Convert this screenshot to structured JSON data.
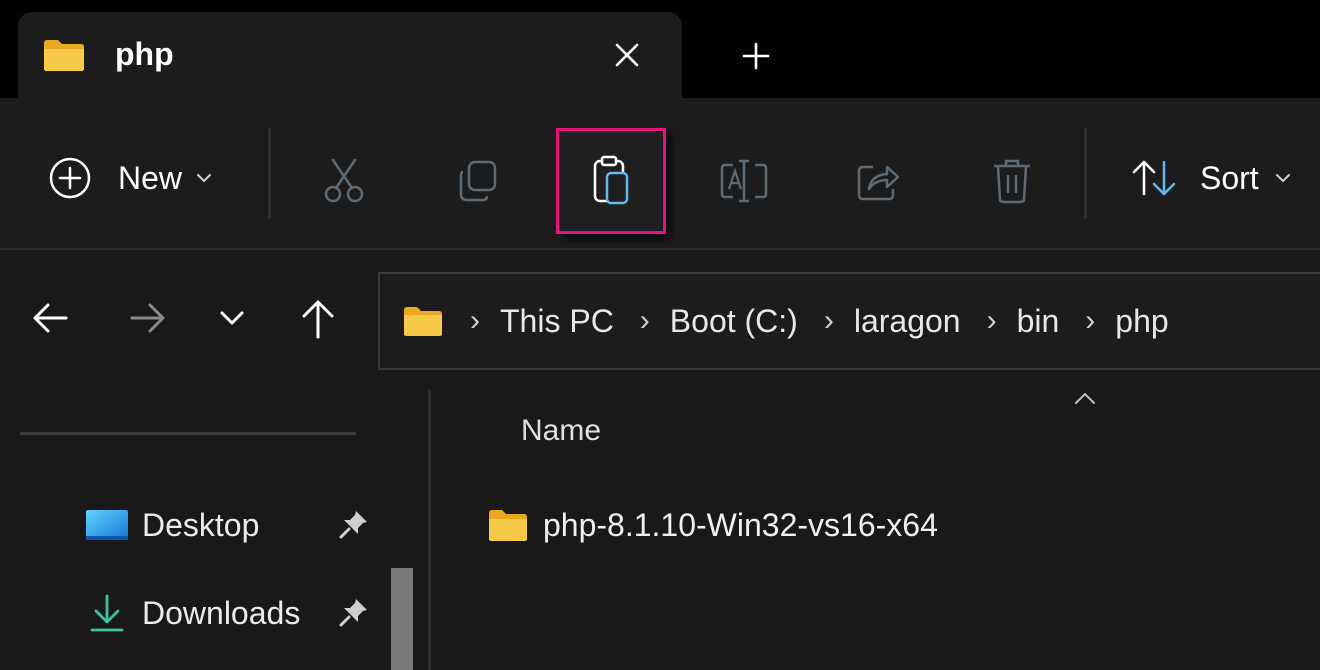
{
  "tab": {
    "title": "php",
    "close_icon": "close-icon",
    "new_tab_icon": "plus-icon"
  },
  "commandbar": {
    "new_label": "New",
    "sort_label": "Sort",
    "buttons": [
      {
        "name": "cut",
        "icon": "scissors-icon",
        "enabled": false
      },
      {
        "name": "copy",
        "icon": "copy-icon",
        "enabled": false
      },
      {
        "name": "paste",
        "icon": "paste-icon",
        "enabled": true,
        "highlighted": true
      },
      {
        "name": "rename",
        "icon": "rename-icon",
        "enabled": false
      },
      {
        "name": "share",
        "icon": "share-icon",
        "enabled": false
      },
      {
        "name": "delete",
        "icon": "trash-icon",
        "enabled": false
      }
    ],
    "highlight_color": "#e3157d"
  },
  "address": {
    "crumbs": [
      "This PC",
      "Boot (C:)",
      "laragon",
      "bin",
      "php"
    ]
  },
  "navpane": {
    "items": [
      {
        "label": "Desktop",
        "icon": "desktop-icon",
        "pinned": true
      },
      {
        "label": "Downloads",
        "icon": "download-icon",
        "pinned": true
      }
    ]
  },
  "filepane": {
    "column_name": "Name",
    "files": [
      {
        "name": "php-8.1.10-Win32-vs16-x64",
        "icon": "folder-icon"
      }
    ]
  },
  "colors": {
    "accent_blue": "#60b8f0",
    "folder_yellow": "#f5c542",
    "disabled_icon": "#5e6a74"
  }
}
